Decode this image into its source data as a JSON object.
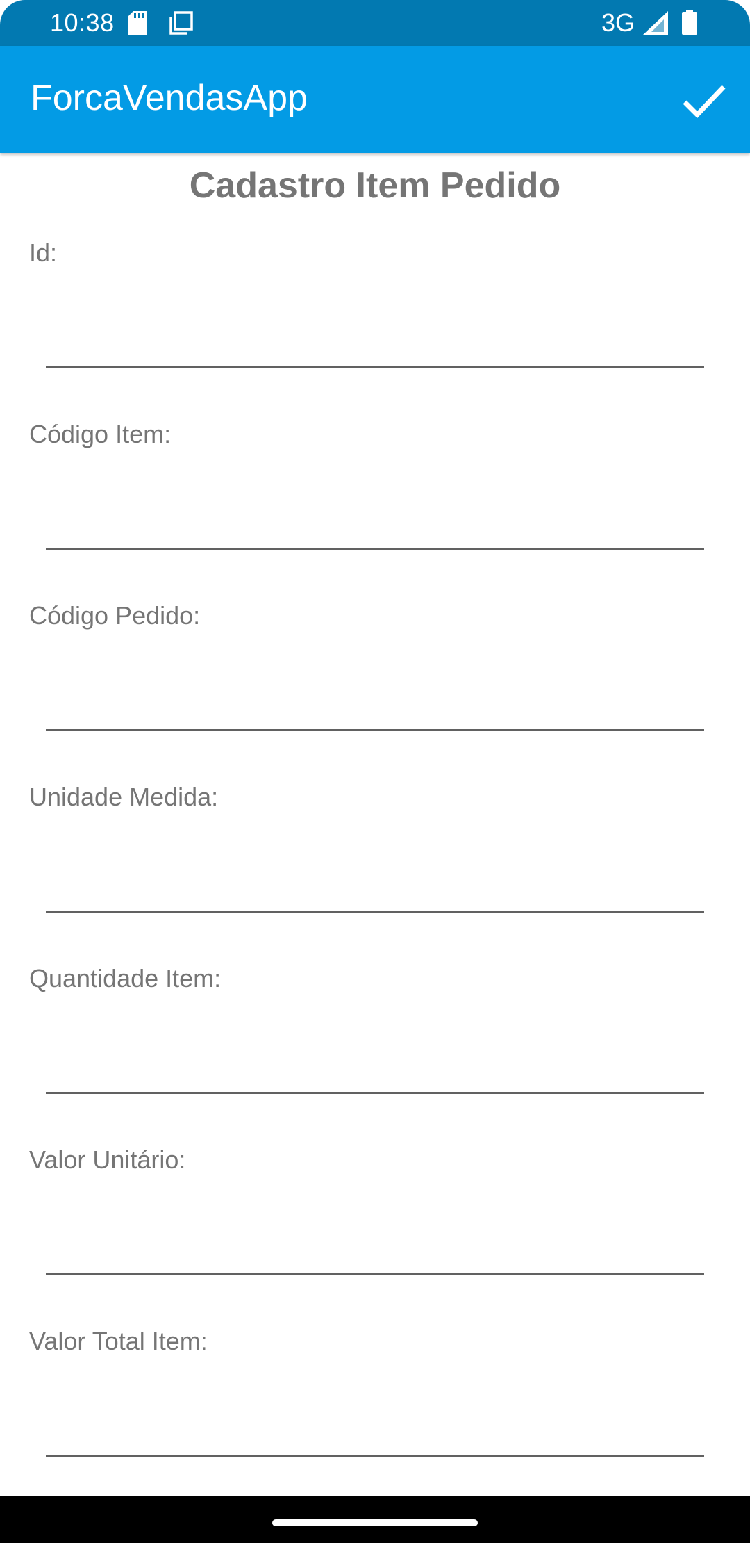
{
  "status_bar": {
    "time": "10:38",
    "network": "3G",
    "icons": [
      "sd-card-icon",
      "copy-icon",
      "signal-icon",
      "battery-icon"
    ]
  },
  "app_bar": {
    "title": "ForcaVendasApp",
    "confirm_icon": "check-icon",
    "background_color": "#039be5"
  },
  "form": {
    "title": "Cadastro Item Pedido",
    "fields": [
      {
        "label": "Id:",
        "value": ""
      },
      {
        "label": "Código Item:",
        "value": ""
      },
      {
        "label": "Código Pedido:",
        "value": ""
      },
      {
        "label": "Unidade Medida:",
        "value": ""
      },
      {
        "label": "Quantidade Item:",
        "value": ""
      },
      {
        "label": "Valor Unitário:",
        "value": ""
      },
      {
        "label": "Valor Total Item:",
        "value": ""
      }
    ]
  },
  "colors": {
    "status_bar": "#0279b1",
    "label_text": "#757575",
    "underline": "#616161"
  }
}
